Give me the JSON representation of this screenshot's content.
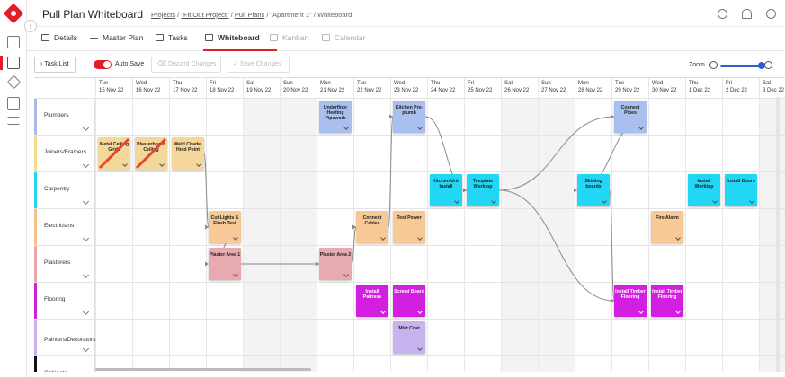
{
  "app": {
    "title": "Pull Plan Whiteboard"
  },
  "breadcrumb": {
    "projects": "Projects",
    "sep1": " / ",
    "project": "\"Fit Out Project\"",
    "sep2": " / ",
    "pull_plans": "Pull Plans",
    "sep3": " / ",
    "plan": "\"Apartment 1\"",
    "sep4": " / ",
    "current": "Whiteboard"
  },
  "tabs": [
    {
      "label": "Details",
      "icon": "details-icon",
      "state": "normal"
    },
    {
      "label": "Master Plan",
      "icon": "master-plan-icon",
      "state": "normal"
    },
    {
      "label": "Tasks",
      "icon": "tasks-icon",
      "state": "normal"
    },
    {
      "label": "Whiteboard",
      "icon": "whiteboard-icon",
      "state": "active"
    },
    {
      "label": "Kanban",
      "icon": "kanban-icon",
      "state": "disabled"
    },
    {
      "label": "Calendar",
      "icon": "calendar-icon",
      "state": "disabled"
    }
  ],
  "toolbar": {
    "task_list": "Task List",
    "auto_save": "Auto Save",
    "auto_save_on": true,
    "discard": "Discard Changes",
    "save": "Save Changes",
    "zoom_label": "Zoom",
    "zoom_level": 0.95
  },
  "dates": [
    {
      "day": "Tue",
      "date": "15 Nov 22",
      "weekend": false
    },
    {
      "day": "Wed",
      "date": "16 Nov 22",
      "weekend": false
    },
    {
      "day": "Thu",
      "date": "17 Nov 22",
      "weekend": false
    },
    {
      "day": "Fri",
      "date": "18 Nov 22",
      "weekend": false
    },
    {
      "day": "Sat",
      "date": "19 Nov 22",
      "weekend": true
    },
    {
      "day": "Sun",
      "date": "20 Nov 22",
      "weekend": true
    },
    {
      "day": "Mon",
      "date": "21 Nov 22",
      "weekend": false
    },
    {
      "day": "Tue",
      "date": "22 Nov 22",
      "weekend": false
    },
    {
      "day": "Wed",
      "date": "23 Nov 22",
      "weekend": false
    },
    {
      "day": "Thu",
      "date": "24 Nov 22",
      "weekend": false
    },
    {
      "day": "Fri",
      "date": "25 Nov 22",
      "weekend": false
    },
    {
      "day": "Sat",
      "date": "26 Nov 22",
      "weekend": true
    },
    {
      "day": "Sun",
      "date": "27 Nov 22",
      "weekend": true
    },
    {
      "day": "Mon",
      "date": "28 Nov 22",
      "weekend": false
    },
    {
      "day": "Tue",
      "date": "29 Nov 22",
      "weekend": false
    },
    {
      "day": "Wed",
      "date": "30 Nov 22",
      "weekend": false
    },
    {
      "day": "Thu",
      "date": "1 Dec 22",
      "weekend": false
    },
    {
      "day": "Fri",
      "date": "2 Dec 22",
      "weekend": false
    },
    {
      "day": "Sat",
      "date": "3 Dec 22",
      "weekend": true
    }
  ],
  "lanes": [
    {
      "name": "Plumbers",
      "color": "#a9b9e8"
    },
    {
      "name": "Joiners/Framers",
      "color": "#f6d98a"
    },
    {
      "name": "Carpentry",
      "color": "#27d3f0"
    },
    {
      "name": "Electricians",
      "color": "#f2c28a"
    },
    {
      "name": "Plasterers",
      "color": "#e8a5ad"
    },
    {
      "name": "Flooring",
      "color": "#d21fd8"
    },
    {
      "name": "Painters/Decorators",
      "color": "#c9b2ec"
    },
    {
      "name": "Cabinets",
      "color": "#111111"
    }
  ],
  "cards": [
    {
      "label": "Underfloor Heating Pipework",
      "lane": 0,
      "day": 6,
      "color": "#a9c0ee",
      "crossed": false,
      "white": false
    },
    {
      "label": "Kitchen Pre-plumb",
      "lane": 0,
      "day": 8,
      "color": "#a9c0ee",
      "crossed": false,
      "white": false
    },
    {
      "label": "Connect Pipes",
      "lane": 0,
      "day": 14,
      "color": "#a9c0ee",
      "crossed": false,
      "white": false
    },
    {
      "label": "Metal Ceiling Grids",
      "lane": 1,
      "day": 0,
      "color": "#f6d79a",
      "crossed": true,
      "white": false
    },
    {
      "label": "Plasterboard Ceiling",
      "lane": 1,
      "day": 1,
      "color": "#f6d79a",
      "crossed": true,
      "white": false
    },
    {
      "label": "Weld Citadel Hold Point",
      "lane": 1,
      "day": 2,
      "color": "#f6d79a",
      "crossed": false,
      "white": false
    },
    {
      "label": "Kitchen Unit Install",
      "lane": 2,
      "day": 9,
      "color": "#22d7f5",
      "crossed": false,
      "white": false
    },
    {
      "label": "Template Worktop",
      "lane": 2,
      "day": 10,
      "color": "#22d7f5",
      "crossed": false,
      "white": false
    },
    {
      "label": "Skirting boards",
      "lane": 2,
      "day": 13,
      "color": "#22d7f5",
      "crossed": false,
      "white": false
    },
    {
      "label": "Install Worktop",
      "lane": 2,
      "day": 16,
      "color": "#22d7f5",
      "crossed": false,
      "white": false
    },
    {
      "label": "Install Doors",
      "lane": 2,
      "day": 17,
      "color": "#22d7f5",
      "crossed": false,
      "white": false
    },
    {
      "label": "Cut Lights & Flush Test",
      "lane": 3,
      "day": 3,
      "color": "#f7c996",
      "crossed": false,
      "white": false
    },
    {
      "label": "Connect Cables",
      "lane": 3,
      "day": 7,
      "color": "#f7c996",
      "crossed": false,
      "white": false
    },
    {
      "label": "Test Power",
      "lane": 3,
      "day": 8,
      "color": "#f7c996",
      "crossed": false,
      "white": false
    },
    {
      "label": "Fire Alarm",
      "lane": 3,
      "day": 15,
      "color": "#f7c996",
      "crossed": false,
      "white": false
    },
    {
      "label": "Plaster Area 1",
      "lane": 4,
      "day": 3,
      "color": "#e7aab0",
      "crossed": false,
      "white": false
    },
    {
      "label": "Plaster Area 2",
      "lane": 4,
      "day": 6,
      "color": "#e7aab0",
      "crossed": false,
      "white": false
    },
    {
      "label": "Install Pattress",
      "lane": 5,
      "day": 7,
      "color": "#d31fe0",
      "crossed": false,
      "white": true
    },
    {
      "label": "Screed Board",
      "lane": 5,
      "day": 8,
      "color": "#d31fe0",
      "crossed": false,
      "white": true
    },
    {
      "label": "Install Timber Flooring",
      "lane": 5,
      "day": 14,
      "color": "#d31fe0",
      "crossed": false,
      "white": true
    },
    {
      "label": "Install Timber Flooring",
      "lane": 5,
      "day": 15,
      "color": "#d31fe0",
      "crossed": false,
      "white": true
    },
    {
      "label": "Mist Coat",
      "lane": 6,
      "day": 8,
      "color": "#c7b3ee",
      "crossed": false,
      "white": false
    }
  ],
  "links": [
    [
      5,
      11
    ],
    [
      11,
      15
    ],
    [
      15,
      16
    ],
    [
      16,
      12
    ],
    [
      12,
      1
    ],
    [
      1,
      7
    ],
    [
      7,
      2
    ],
    [
      2,
      8
    ],
    [
      8,
      19
    ],
    [
      7,
      19
    ]
  ]
}
